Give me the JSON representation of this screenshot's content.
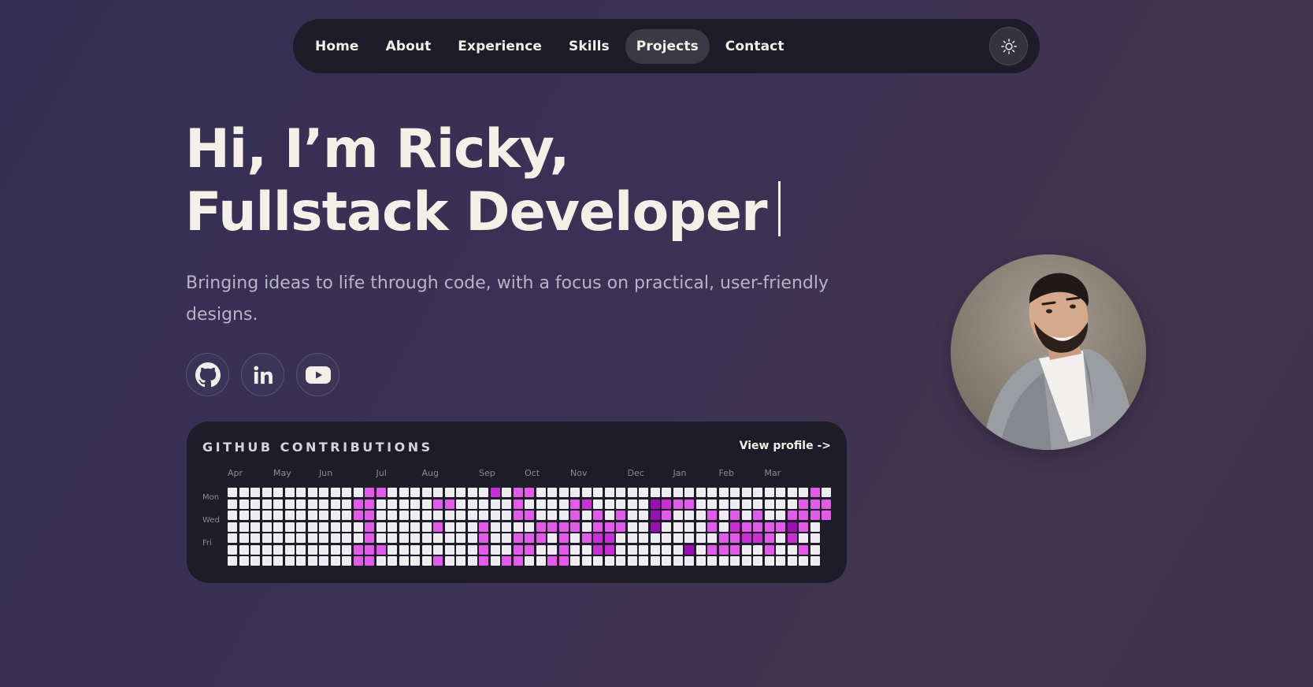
{
  "nav": {
    "items": [
      {
        "label": "Home",
        "active": false
      },
      {
        "label": "About",
        "active": false
      },
      {
        "label": "Experience",
        "active": false
      },
      {
        "label": "Skills",
        "active": false
      },
      {
        "label": "Projects",
        "active": true
      },
      {
        "label": "Contact",
        "active": false
      }
    ],
    "theme_toggle_icon": "sun-icon"
  },
  "hero": {
    "line1": "Hi, I’m Ricky,",
    "line2": "Fullstack Developer",
    "subtitle": "Bringing ideas to life through code, with a focus on practical, user-friendly designs."
  },
  "socials": [
    {
      "name": "github",
      "icon": "github-icon"
    },
    {
      "name": "linkedin",
      "icon": "linkedin-icon"
    },
    {
      "name": "youtube",
      "icon": "youtube-icon"
    }
  ],
  "github": {
    "title": "GITHUB CONTRIBUTIONS",
    "link_label": "View profile ->",
    "months": [
      "Apr",
      "May",
      "Jun",
      "Jul",
      "Aug",
      "Sep",
      "Oct",
      "Nov",
      "Dec",
      "Jan",
      "Feb",
      "Mar"
    ],
    "month_weeks": [
      0,
      4,
      8,
      13,
      17,
      22,
      26,
      30,
      35,
      39,
      43,
      47
    ],
    "day_labels": [
      "Mon",
      "Wed",
      "Fri"
    ],
    "day_label_rows": [
      1,
      3,
      5
    ],
    "weeks": 53,
    "last_week_days": 3,
    "colors": {
      "0": "#efedf2",
      "1": "#e05be6",
      "2": "#c830d4",
      "3": "#9a0fb1"
    },
    "active_cells": [
      [
        11,
        1,
        1
      ],
      [
        11,
        2,
        1
      ],
      [
        11,
        5,
        1
      ],
      [
        11,
        6,
        1
      ],
      [
        12,
        0,
        1
      ],
      [
        12,
        1,
        1
      ],
      [
        12,
        2,
        1
      ],
      [
        12,
        3,
        1
      ],
      [
        12,
        4,
        1
      ],
      [
        12,
        5,
        1
      ],
      [
        12,
        6,
        1
      ],
      [
        13,
        0,
        1
      ],
      [
        13,
        5,
        1
      ],
      [
        18,
        1,
        1
      ],
      [
        18,
        3,
        1
      ],
      [
        18,
        6,
        1
      ],
      [
        19,
        1,
        1
      ],
      [
        22,
        3,
        1
      ],
      [
        22,
        4,
        1
      ],
      [
        22,
        5,
        1
      ],
      [
        22,
        6,
        1
      ],
      [
        23,
        0,
        2
      ],
      [
        24,
        6,
        1
      ],
      [
        25,
        0,
        1
      ],
      [
        25,
        1,
        1
      ],
      [
        25,
        2,
        1
      ],
      [
        25,
        4,
        1
      ],
      [
        25,
        5,
        1
      ],
      [
        25,
        6,
        1
      ],
      [
        26,
        0,
        1
      ],
      [
        26,
        2,
        1
      ],
      [
        26,
        4,
        1
      ],
      [
        26,
        5,
        1
      ],
      [
        27,
        3,
        1
      ],
      [
        27,
        4,
        1
      ],
      [
        28,
        3,
        1
      ],
      [
        28,
        6,
        1
      ],
      [
        29,
        3,
        1
      ],
      [
        29,
        4,
        1
      ],
      [
        29,
        5,
        1
      ],
      [
        29,
        6,
        1
      ],
      [
        30,
        1,
        1
      ],
      [
        30,
        2,
        1
      ],
      [
        30,
        3,
        1
      ],
      [
        31,
        1,
        2
      ],
      [
        31,
        4,
        1
      ],
      [
        32,
        2,
        1
      ],
      [
        32,
        3,
        1
      ],
      [
        32,
        4,
        2
      ],
      [
        32,
        5,
        2
      ],
      [
        33,
        3,
        1
      ],
      [
        33,
        4,
        2
      ],
      [
        33,
        5,
        2
      ],
      [
        34,
        2,
        1
      ],
      [
        34,
        3,
        1
      ],
      [
        37,
        1,
        3
      ],
      [
        37,
        2,
        3
      ],
      [
        37,
        3,
        3
      ],
      [
        38,
        1,
        2
      ],
      [
        38,
        2,
        1
      ],
      [
        39,
        1,
        1
      ],
      [
        40,
        1,
        1
      ],
      [
        40,
        5,
        3
      ],
      [
        42,
        2,
        1
      ],
      [
        42,
        3,
        1
      ],
      [
        42,
        5,
        1
      ],
      [
        43,
        4,
        1
      ],
      [
        43,
        5,
        1
      ],
      [
        44,
        2,
        1
      ],
      [
        44,
        3,
        2
      ],
      [
        44,
        4,
        1
      ],
      [
        44,
        5,
        1
      ],
      [
        45,
        3,
        1
      ],
      [
        45,
        4,
        2
      ],
      [
        46,
        2,
        1
      ],
      [
        46,
        3,
        1
      ],
      [
        46,
        4,
        2
      ],
      [
        47,
        3,
        1
      ],
      [
        47,
        4,
        1
      ],
      [
        47,
        5,
        1
      ],
      [
        48,
        3,
        1
      ],
      [
        49,
        2,
        1
      ],
      [
        49,
        3,
        3
      ],
      [
        49,
        4,
        2
      ],
      [
        50,
        1,
        1
      ],
      [
        50,
        2,
        1
      ],
      [
        50,
        3,
        1
      ],
      [
        50,
        5,
        1
      ],
      [
        51,
        0,
        1
      ],
      [
        51,
        1,
        1
      ],
      [
        51,
        2,
        1
      ],
      [
        52,
        1,
        1
      ],
      [
        52,
        2,
        1
      ]
    ]
  }
}
